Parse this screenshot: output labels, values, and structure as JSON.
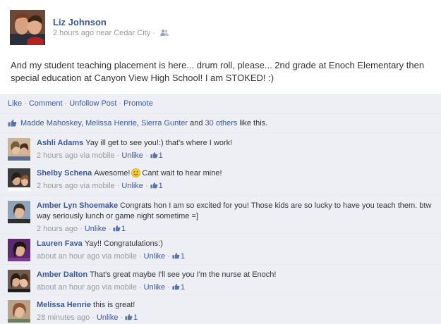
{
  "post": {
    "author": "Liz Johnson",
    "time": "2 hours ago near Cedar City",
    "text": "And my student teaching placement is here... drum roll, please... 2nd grade at Enoch Elementary then special education at Canyon View High School! I am STOKED! :)",
    "audience_icon": "friends-icon"
  },
  "actions": {
    "like": "Like",
    "comment": "Comment",
    "unfollow": "Unfollow Post",
    "promote": "Promote"
  },
  "likes": {
    "name1": "Madde Mahoskey",
    "name2": "Melissa Henrie",
    "name3": "Sierra Gunter",
    "and": "and",
    "others": "30 others",
    "suffix": "like this."
  },
  "comments": [
    {
      "name": "Ashli Adams",
      "text": "Yay ill get to see you!:) that's where I work!",
      "time": "2 hours ago via mobile",
      "unlike": "Unlike",
      "likes": "1"
    },
    {
      "name": "Shelby Schena",
      "text_before": "Awesome!",
      "text_after": "Cant wait to hear mine!",
      "time": "2 hours ago via mobile",
      "unlike": "Unlike",
      "likes": "1"
    },
    {
      "name": "Amber Lyn Shoemake",
      "text": "Congrats hon I am so excited for you! Those kids are so lucky to have you teach them. btw way seriously lunch or game night sometime =]",
      "time": "2 hours ago",
      "unlike": "Unlike",
      "likes": "1"
    },
    {
      "name": "Lauren Fava",
      "text": "Yay!! Congratulations:)",
      "time": "about an hour ago via mobile",
      "unlike": "Unlike",
      "likes": "1"
    },
    {
      "name": "Amber Dalton",
      "text": "That's great maybe I'll see you I'm the nurse at Enoch!",
      "time": "about an hour ago via mobile",
      "unlike": "Unlike",
      "likes": "1"
    },
    {
      "name": "Melissa Henrie",
      "text": "this is great!",
      "time": "28 minutes ago",
      "unlike": "Unlike",
      "likes": "1"
    }
  ],
  "colors": {
    "link": "#3b5998",
    "ufi_background": "#edeff4",
    "muted": "#999999"
  }
}
